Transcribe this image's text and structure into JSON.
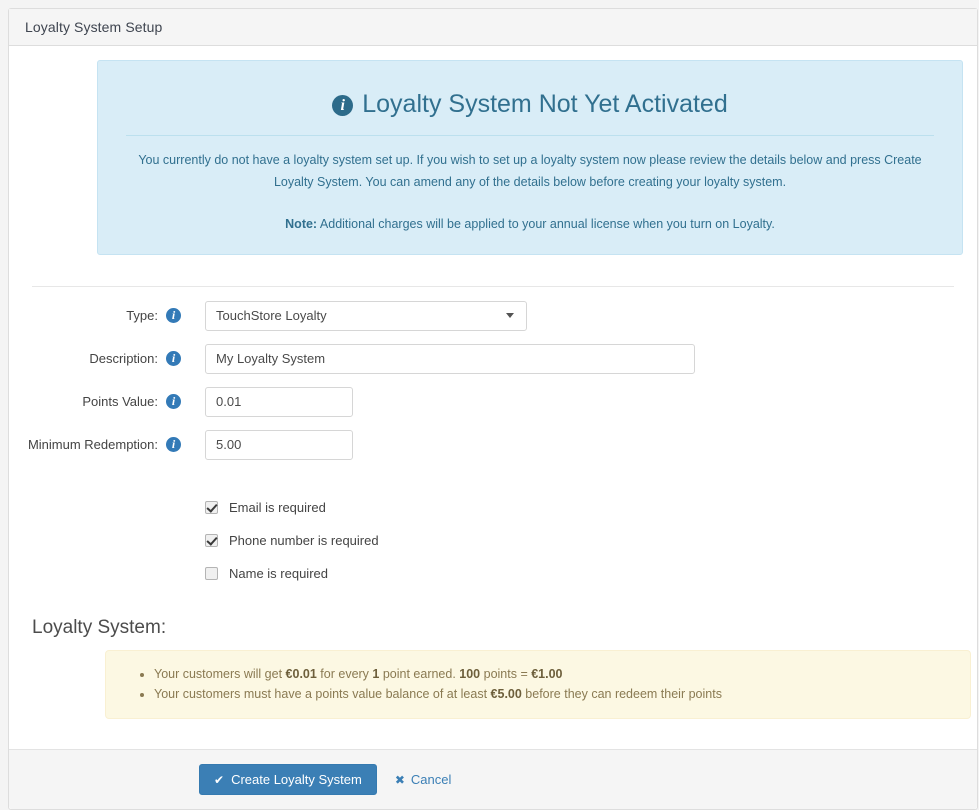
{
  "panel": {
    "title": "Loyalty System Setup"
  },
  "alert": {
    "icon": "info-circle-icon",
    "title": "Loyalty System Not Yet Activated",
    "body": "You currently do not have a loyalty system set up. If you wish to set up a loyalty system now please review the details below and press Create Loyalty System. You can amend any of the details below before creating your loyalty system.",
    "note_label": "Note:",
    "note_text": "Additional charges will be applied to your annual license when you turn on Loyalty."
  },
  "form": {
    "fields": [
      {
        "label": "Type:",
        "icon": "info-circle-icon",
        "control": "select",
        "value": "TouchStore Loyalty",
        "options": [
          "TouchStore Loyalty"
        ]
      },
      {
        "label": "Description:",
        "icon": "info-circle-icon",
        "control": "text",
        "value": "My Loyalty System"
      },
      {
        "label": "Points Value:",
        "icon": "info-circle-icon",
        "control": "text",
        "value": "0.01"
      },
      {
        "label": "Minimum Redemption:",
        "icon": "info-circle-icon",
        "control": "text",
        "value": "5.00"
      }
    ],
    "checkboxes": [
      {
        "label": "Email is required",
        "checked": true
      },
      {
        "label": "Phone number is required",
        "checked": true
      },
      {
        "label": "Name is required",
        "checked": false
      }
    ]
  },
  "summary": {
    "title": "Loyalty System:",
    "items": [
      {
        "parts": [
          {
            "text": "Your customers will get ",
            "bold": false
          },
          {
            "text": "€0.01",
            "bold": true
          },
          {
            "text": " for every ",
            "bold": false
          },
          {
            "text": "1",
            "bold": true
          },
          {
            "text": " point earned. ",
            "bold": false
          },
          {
            "text": "100",
            "bold": true
          },
          {
            "text": " points = ",
            "bold": false
          },
          {
            "text": "€1.00",
            "bold": true
          }
        ]
      },
      {
        "parts": [
          {
            "text": "Your customers must have a points value balance of at least ",
            "bold": false
          },
          {
            "text": "€5.00",
            "bold": true
          },
          {
            "text": " before they can redeem their points",
            "bold": false
          }
        ]
      }
    ]
  },
  "footer": {
    "create_icon": "check-icon",
    "create_label": "Create Loyalty System",
    "cancel_icon": "close-x-icon",
    "cancel_label": "Cancel"
  },
  "colors": {
    "primary": "#3b7fb5",
    "alert_bg": "#d9edf7",
    "alert_text": "#31708f",
    "warning_bg": "#fcf8e3",
    "warning_text": "#8a7a52"
  }
}
